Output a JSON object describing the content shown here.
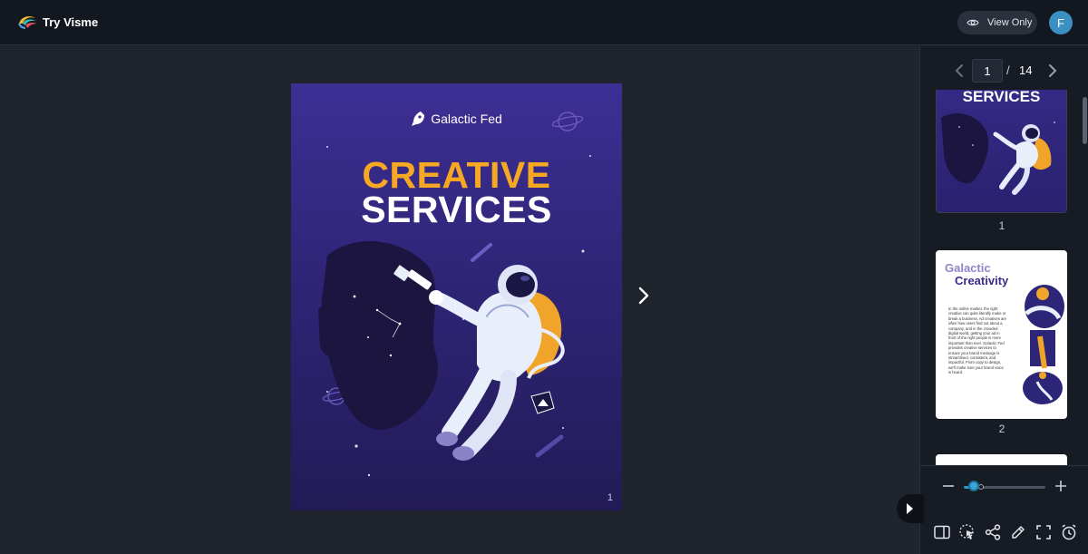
{
  "header": {
    "app_title": "Try Visme",
    "view_only_label": "View Only",
    "avatar_initial": "F"
  },
  "page": {
    "brand_name": "Galactic Fed",
    "headline_line1": "CREATIVE",
    "headline_line2": "SERVICES",
    "page_number": "1",
    "colors": {
      "accent": "#f7a823",
      "background_top": "#3d2f94",
      "background_bottom": "#231b57"
    }
  },
  "navigation": {
    "current_page": "1",
    "separator": "/",
    "total_pages": "14"
  },
  "thumbnails": [
    {
      "title": "SERVICES",
      "label": "1"
    },
    {
      "title_line1": "Galactic",
      "title_line2": "Creativity",
      "body": "In the online market, the right creative can quite literally make or break a business. Ad creatives are often how users find out about a company, and in the crowded digital world, getting your ad in front of the right people is more important than ever. Galactic Fed provides creative services to ensure your brand message is streamlined, consistent, and impactful. From copy to design, we'll make sure your brand voice is heard.",
      "label": "2"
    }
  ],
  "zoom": {
    "level": 0.12
  },
  "toolbar": {
    "tools": [
      "panel-icon",
      "select-icon",
      "share-icon",
      "pencil-icon",
      "fullscreen-icon",
      "timer-icon"
    ]
  }
}
